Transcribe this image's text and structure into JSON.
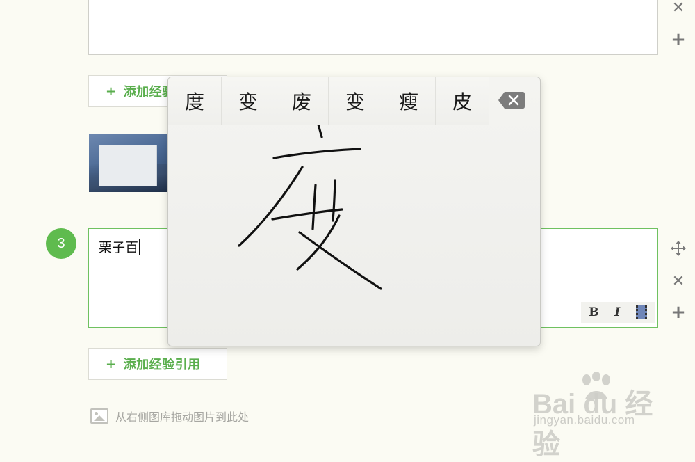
{
  "add_reference_label": "添加经验引用",
  "step": {
    "number": "3"
  },
  "editor": {
    "text": "栗子百",
    "format": {
      "bold": "B",
      "italic": "I"
    }
  },
  "drag_hint": "从右侧图库拖动图片到此处",
  "handwriting": {
    "candidates": [
      "度",
      "变",
      "废",
      "变",
      "瘦",
      "皮"
    ]
  },
  "watermark": {
    "brand": "Bai du 经验",
    "url": "jingyan.baidu.com"
  },
  "colors": {
    "accent_green": "#5fbb4e",
    "add_text_green": "#5aae4d",
    "border_green": "#6fc160"
  },
  "icons": {
    "move": "move-arrows-icon",
    "delete": "close-icon",
    "add": "plus-icon",
    "backspace": "backspace-icon",
    "image": "image-icon",
    "video": "film-icon"
  }
}
